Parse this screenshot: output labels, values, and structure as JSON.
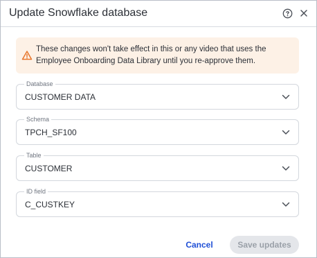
{
  "dialog": {
    "title": "Update Snowflake database",
    "help_icon": "help-circle-icon",
    "close_icon": "close-icon"
  },
  "warning": {
    "icon": "warning-triangle-icon",
    "text": "These changes won't take effect in this or any video that uses the Employee Onboarding Data Library until you re-approve them.",
    "color": "#e8762c",
    "background": "#fdf1e6"
  },
  "fields": [
    {
      "label": "Database",
      "value": "CUSTOMER DATA"
    },
    {
      "label": "Schema",
      "value": "TPCH_SF100"
    },
    {
      "label": "Table",
      "value": "CUSTOMER"
    },
    {
      "label": "ID field",
      "value": "C_CUSTKEY"
    }
  ],
  "footer": {
    "cancel_label": "Cancel",
    "save_label": "Save updates",
    "accent": "#1f4fd6"
  }
}
